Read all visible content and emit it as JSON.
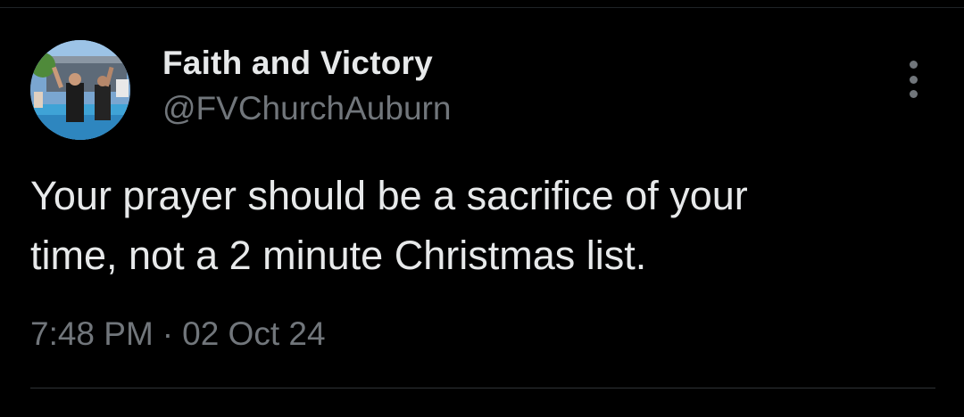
{
  "author": {
    "display_name": "Faith and Victory",
    "handle": "@FVChurchAuburn",
    "avatar": "profile-photo"
  },
  "tweet": {
    "text": "Your prayer should be a sacrifice of your\ntime, not a 2 minute Christmas list.",
    "time": "7:48 PM",
    "separator": "·",
    "date": "02 Oct 24"
  },
  "actions": {
    "more_icon": "more-vertical-icon"
  },
  "colors": {
    "background": "#000000",
    "primary_text": "#e7e9ea",
    "secondary_text": "#71767b",
    "divider": "#2f3336"
  }
}
